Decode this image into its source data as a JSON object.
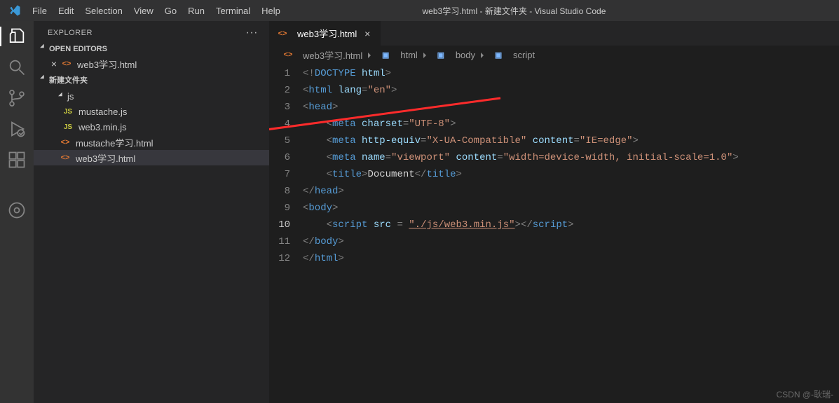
{
  "titlebar": {
    "menu": [
      "File",
      "Edit",
      "Selection",
      "View",
      "Go",
      "Run",
      "Terminal",
      "Help"
    ],
    "title": "web3学习.html - 新建文件夹 - Visual Studio Code"
  },
  "sidebar": {
    "header": "EXPLORER",
    "open_editors_label": "OPEN EDITORS",
    "open_editors": [
      {
        "name": "web3学习.html",
        "icon": "<>"
      }
    ],
    "workspace_label": "新建文件夹",
    "tree": [
      {
        "type": "folder",
        "name": "js",
        "level": 2
      },
      {
        "type": "file",
        "name": "mustache.js",
        "icon": "JS",
        "iconcls": "fi-js",
        "level": 3
      },
      {
        "type": "file",
        "name": "web3.min.js",
        "icon": "JS",
        "iconcls": "fi-js",
        "level": 3
      },
      {
        "type": "file",
        "name": "mustache学习.html",
        "icon": "<>",
        "iconcls": "fi-html",
        "level": 2
      },
      {
        "type": "file",
        "name": "web3学习.html",
        "icon": "<>",
        "iconcls": "fi-html",
        "level": 2,
        "active": true
      }
    ]
  },
  "editor": {
    "tab": {
      "icon": "<>",
      "label": "web3学习.html"
    },
    "breadcrumbs": [
      {
        "icon": "<>",
        "iconcls": "fi-html",
        "label": "web3学习.html"
      },
      {
        "icon": "▣",
        "iconcls": "bc-cube",
        "label": "html"
      },
      {
        "icon": "▣",
        "iconcls": "bc-cube",
        "label": "body"
      },
      {
        "icon": "▣",
        "iconcls": "bc-cube",
        "label": "script"
      }
    ],
    "current_line": 10,
    "lines": [
      {
        "n": 1,
        "html": "<span class='t-punc'>&lt;!</span><span class='t-doctype'>DOCTYPE</span> <span class='t-attr'>html</span><span class='t-punc'>&gt;</span>"
      },
      {
        "n": 2,
        "html": "<span class='t-punc'>&lt;</span><span class='t-tag'>html</span> <span class='t-attr'>lang</span><span class='t-punc'>=</span><span class='t-str'>\"en\"</span><span class='t-punc'>&gt;</span>"
      },
      {
        "n": 3,
        "html": "<span class='t-punc'>&lt;</span><span class='t-tag'>head</span><span class='t-punc'>&gt;</span>"
      },
      {
        "n": 4,
        "html": "    <span class='t-punc'>&lt;</span><span class='t-tag'>meta</span> <span class='t-attr'>charset</span><span class='t-punc'>=</span><span class='t-str'>\"UTF-8\"</span><span class='t-punc'>&gt;</span>"
      },
      {
        "n": 5,
        "html": "    <span class='t-punc'>&lt;</span><span class='t-tag'>meta</span> <span class='t-attr'>http-equiv</span><span class='t-punc'>=</span><span class='t-str'>\"X-UA-Compatible\"</span> <span class='t-attr'>content</span><span class='t-punc'>=</span><span class='t-str'>\"IE=edge\"</span><span class='t-punc'>&gt;</span>"
      },
      {
        "n": 6,
        "html": "    <span class='t-punc'>&lt;</span><span class='t-tag'>meta</span> <span class='t-attr'>name</span><span class='t-punc'>=</span><span class='t-str'>\"viewport\"</span> <span class='t-attr'>content</span><span class='t-punc'>=</span><span class='t-str'>\"width=device-width, initial-scale=1.0\"</span><span class='t-punc'>&gt;</span>"
      },
      {
        "n": 7,
        "html": "    <span class='t-punc'>&lt;</span><span class='t-tag'>title</span><span class='t-punc'>&gt;</span><span class='t-text'>Document</span><span class='t-punc'>&lt;/</span><span class='t-tag'>title</span><span class='t-punc'>&gt;</span>"
      },
      {
        "n": 8,
        "html": "<span class='t-punc'>&lt;/</span><span class='t-tag'>head</span><span class='t-punc'>&gt;</span>"
      },
      {
        "n": 9,
        "html": "<span class='t-punc'>&lt;</span><span class='t-tag'>body</span><span class='t-punc'>&gt;</span>"
      },
      {
        "n": 10,
        "html": "    <span class='t-punc'>&lt;</span><span class='t-tag'>script</span> <span class='t-attr'>src</span> <span class='t-punc'>=</span> <span class='t-str underline'>\"./js/web3.min.js\"</span><span class='t-punc'>&gt;&lt;/</span><span class='t-tag'>script</span><span class='t-punc'>&gt;</span>"
      },
      {
        "n": 11,
        "html": "<span class='t-punc'>&lt;/</span><span class='t-tag'>body</span><span class='t-punc'>&gt;</span>"
      },
      {
        "n": 12,
        "html": "<span class='t-punc'>&lt;/</span><span class='t-tag'>html</span><span class='t-punc'>&gt;</span>"
      }
    ]
  },
  "watermark": "CSDN @-耿瑞-"
}
